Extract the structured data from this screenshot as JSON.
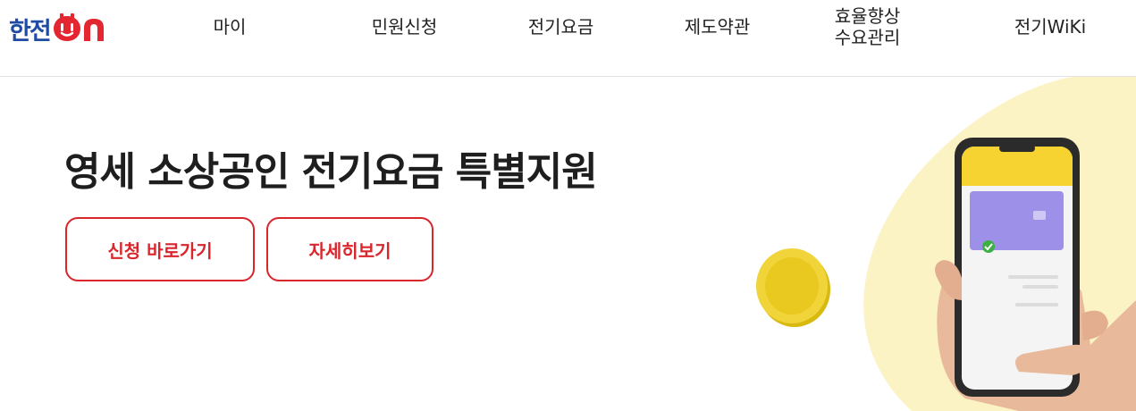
{
  "header": {
    "logo": {
      "korean": "한전",
      "mark": "ON"
    },
    "nav": [
      {
        "label": "마이"
      },
      {
        "label": "민원신청"
      },
      {
        "label": "전기요금"
      },
      {
        "label": "제도약관"
      },
      {
        "label_line1": "효율향상",
        "label_line2": "수요관리"
      },
      {
        "label": "전기WiKi"
      }
    ]
  },
  "hero": {
    "title": "영세 소상공인 전기요금 특별지원",
    "buttons": {
      "apply": "신청 바로가기",
      "detail": "자세히보기"
    }
  },
  "colors": {
    "brand_blue": "#1f4ba5",
    "brand_red": "#d9252c",
    "accent_yellow": "#fbf3c4"
  },
  "icons": {
    "logo_mark": "power-plug-on-icon",
    "illustration": "hand-holding-phone-with-coin"
  }
}
